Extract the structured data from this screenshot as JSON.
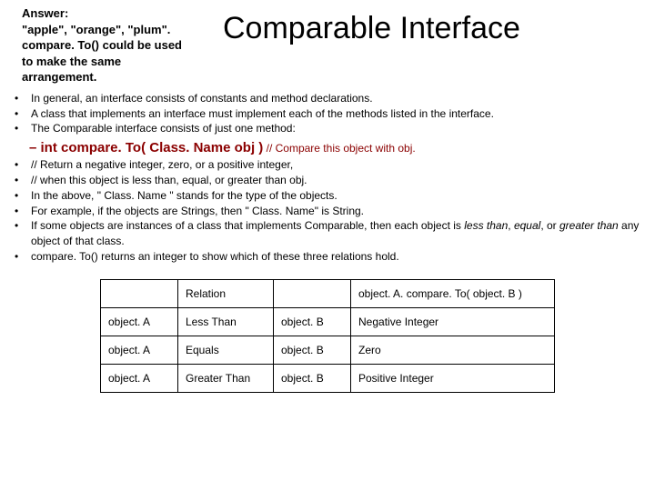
{
  "header": {
    "answer_label": "Answer:",
    "answer_line1": "\"apple\", \"orange\", \"plum\".",
    "answer_line2": "compare. To() could be used to make the same arrangement.",
    "title": "Comparable Interface"
  },
  "bullets1": [
    "In general, an interface consists of constants and method declarations.",
    "A class that implements an interface must implement each of the methods listed in the interface.",
    "The Comparable interface consists of just one method:"
  ],
  "dash": {
    "prefix": "– int compare. To( Class. Name obj )",
    "comment": " // Compare this object with obj."
  },
  "bullets2": [
    {
      "t": "// Return a negative integer, zero, or a positive integer,"
    },
    {
      "t": "// when this object is less than, equal, or greater than obj."
    },
    {
      "t": "In the above, \" Class. Name \" stands for the type of the objects."
    },
    {
      "t": "For example, if the objects are Strings, then \" Class. Name\" is String."
    }
  ],
  "bullet_italic": {
    "pre": "If some objects are instances of a class that implements Comparable, then each object is ",
    "i1": "less than",
    "mid1": ", ",
    "i2": "equal",
    "mid2": ", or ",
    "i3": "greater than",
    "post": " any object of that class."
  },
  "bullet_last": "compare. To() returns an integer to show which of these three relations hold.",
  "table": {
    "h_relation": "Relation",
    "h_result": "object. A. compare. To( object. B )",
    "rows": [
      {
        "a": "object. A",
        "rel": "Less Than",
        "b": "object. B",
        "res": "Negative Integer"
      },
      {
        "a": "object. A",
        "rel": "Equals",
        "b": "object. B",
        "res": "Zero"
      },
      {
        "a": "object. A",
        "rel": "Greater Than",
        "b": "object. B",
        "res": "Positive Integer"
      }
    ]
  }
}
